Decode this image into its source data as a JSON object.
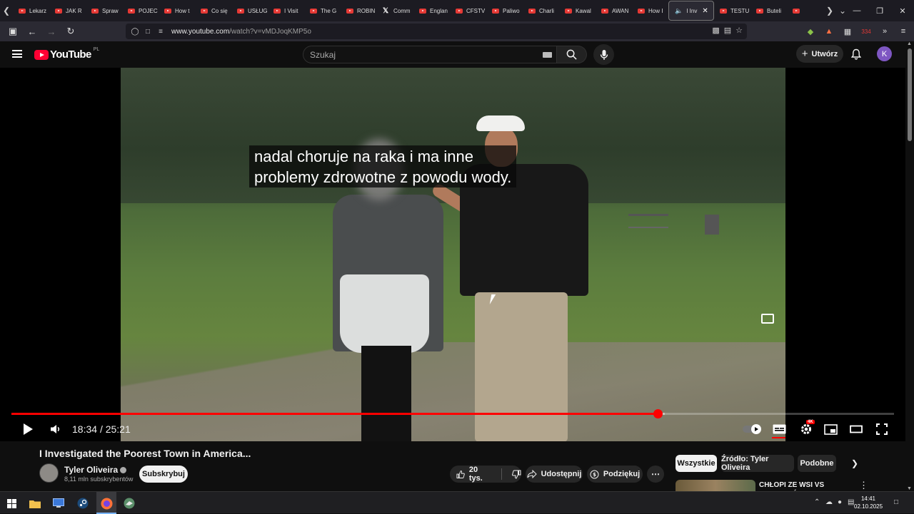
{
  "browser": {
    "tabs": [
      {
        "label": "Lekarz",
        "type": "youtube"
      },
      {
        "label": "JAK R",
        "type": "youtube"
      },
      {
        "label": "Spraw",
        "type": "youtube"
      },
      {
        "label": "POJEC",
        "type": "youtube"
      },
      {
        "label": "How t",
        "type": "youtube"
      },
      {
        "label": "Co się",
        "type": "youtube"
      },
      {
        "label": "USŁUG",
        "type": "youtube"
      },
      {
        "label": "I Visit",
        "type": "youtube"
      },
      {
        "label": "The G",
        "type": "youtube"
      },
      {
        "label": "ROBIN",
        "type": "youtube"
      },
      {
        "label": "Comm",
        "type": "x"
      },
      {
        "label": "Englan",
        "type": "youtube"
      },
      {
        "label": "CFSTV",
        "type": "youtube"
      },
      {
        "label": "Paliwo",
        "type": "youtube"
      },
      {
        "label": "Charli",
        "type": "youtube"
      },
      {
        "label": "Kawal",
        "type": "youtube"
      },
      {
        "label": "AWAN",
        "type": "youtube"
      },
      {
        "label": "How I",
        "type": "youtube"
      }
    ],
    "active_tab": {
      "label": "I Inv"
    },
    "tabs_after": [
      {
        "label": "TESTU",
        "type": "youtube"
      },
      {
        "label": "Buteli",
        "type": "youtube"
      },
      {
        "label": "",
        "type": "youtube"
      }
    ],
    "url_domain": "www.youtube.com",
    "url_path": "/watch?v=vMDJoqKMP5o",
    "extension_badge": "334"
  },
  "header": {
    "logo_text": "YouTube",
    "country_code": "PL",
    "search_placeholder": "Szukaj",
    "create_label": "Utwórz",
    "avatar_letter": "K"
  },
  "player": {
    "caption_line1": "nadal choruje na raka i ma inne",
    "caption_line2": "problemy zdrowotne z powodu wody.",
    "current_time": "18:34",
    "duration": "25:21",
    "progress_fraction": 0.7324,
    "buffered_fraction": 0.74,
    "quality_badge": "4K"
  },
  "video": {
    "title": "I Investigated the Poorest Town in America...",
    "channel_name": "Tyler Oliveira",
    "subscribers": "8,11 mln subskrybentów",
    "subscribe_label": "Subskrybuj",
    "likes": "20 tys.",
    "share_label": "Udostępnij",
    "thanks_label": "Podziękuj"
  },
  "recommendations": {
    "chips": [
      "Wszystkie",
      "Źródło: Tyler Oliveira",
      "Podobne"
    ],
    "active_chip": "Wszystkie",
    "first_title": "CHŁOPI ZE WSI VS KULTURYŚCI - KTO JEST"
  },
  "taskbar": {
    "time": "14:41",
    "date": "02.10.2025"
  },
  "colors": {
    "accent_red": "#ff0000",
    "youtube_red": "#ff0033",
    "background": "#0f0f0f"
  }
}
